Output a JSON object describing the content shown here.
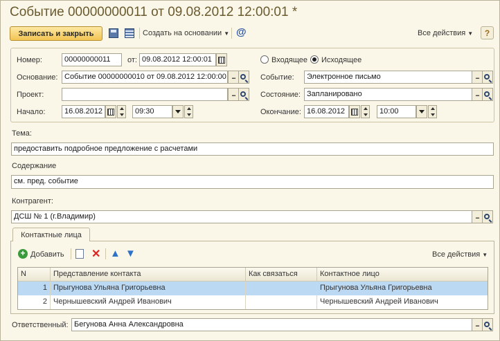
{
  "window": {
    "title": "Событие 00000000011 от 09.08.2012 12:00:01 *"
  },
  "toolbar": {
    "write_close": "Записать и закрыть",
    "create_based": "Создать на основании",
    "all_actions": "Все действия",
    "help": "?"
  },
  "form": {
    "number_label": "Номер:",
    "number": "00000000011",
    "date_label": "от:",
    "date": "09.08.2012 12:00:01",
    "radio_incoming": "Входящее",
    "radio_outgoing": "Исходящее",
    "basis_label": "Основание:",
    "basis": "Событие 00000000010 от 09.08.2012 12:00:00",
    "event_label": "Событие:",
    "event": "Электронное письмо",
    "project_label": "Проект:",
    "project": "",
    "status_label": "Состояние:",
    "status": "Запланировано",
    "start_label": "Начало:",
    "start_date": "16.08.2012",
    "start_time": "09:30",
    "end_label": "Окончание:",
    "end_date": "16.08.2012",
    "end_time": "10:00",
    "subject_label": "Тема:",
    "subject": "предоставить подробное предложение с расчетами",
    "content_label": "Содержание",
    "content": "см. пред. событие",
    "counterparty_label": "Контрагент:",
    "counterparty": "ДСШ № 1 (г.Владимир)",
    "responsible_label": "Ответственный:",
    "responsible": "Бегунова Анна Александровна"
  },
  "contacts": {
    "tab_label": "Контактные лица",
    "add_label": "Добавить",
    "all_actions": "Все действия",
    "columns": [
      "N",
      "Представление контакта",
      "Как связаться",
      "Контактное лицо"
    ],
    "rows": [
      {
        "n": "1",
        "presentation": "Прыгунова Ульяна Григорьевна",
        "how": "",
        "person": "Прыгунова Ульяна Григорьевна"
      },
      {
        "n": "2",
        "presentation": "Чернышевский Андрей Иванович",
        "how": "",
        "person": "Чернышевский Андрей Иванович"
      }
    ]
  },
  "colors": {
    "accent": "#f2c453",
    "selection": "#bcd9f3",
    "background": "#fbf7e8",
    "title": "#6a5a2e"
  }
}
